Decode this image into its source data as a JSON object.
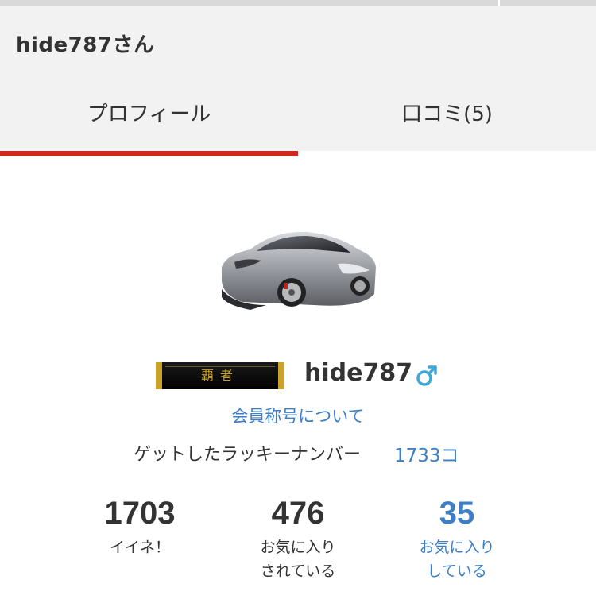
{
  "header": {
    "title": "hide787さん",
    "tabs": [
      {
        "label": "プロフィール",
        "active": true
      },
      {
        "label": "口コミ(5)",
        "active": false
      }
    ]
  },
  "profile": {
    "avatar": "car-photo",
    "rank_badge_text": "覇者",
    "username": "hide787",
    "gender_icon": "male-icon",
    "title_link": "会員称号について",
    "lucky_label": "ゲットしたラッキーナンバー",
    "lucky_value": "1733コ"
  },
  "stats": [
    {
      "value": "1703",
      "label_line1": "イイネ！",
      "label_line2": ""
    },
    {
      "value": "476",
      "label_line1": "お気に入り",
      "label_line2": "されている"
    },
    {
      "value": "35",
      "label_line1": "お気に入り",
      "label_line2": "している"
    }
  ],
  "colors": {
    "accent_red": "#d0271e",
    "link_blue": "#3c7fc7",
    "header_bg": "#f2f2f2",
    "gender_blue": "#3fa7d6",
    "badge_gold": "#c9a227"
  }
}
